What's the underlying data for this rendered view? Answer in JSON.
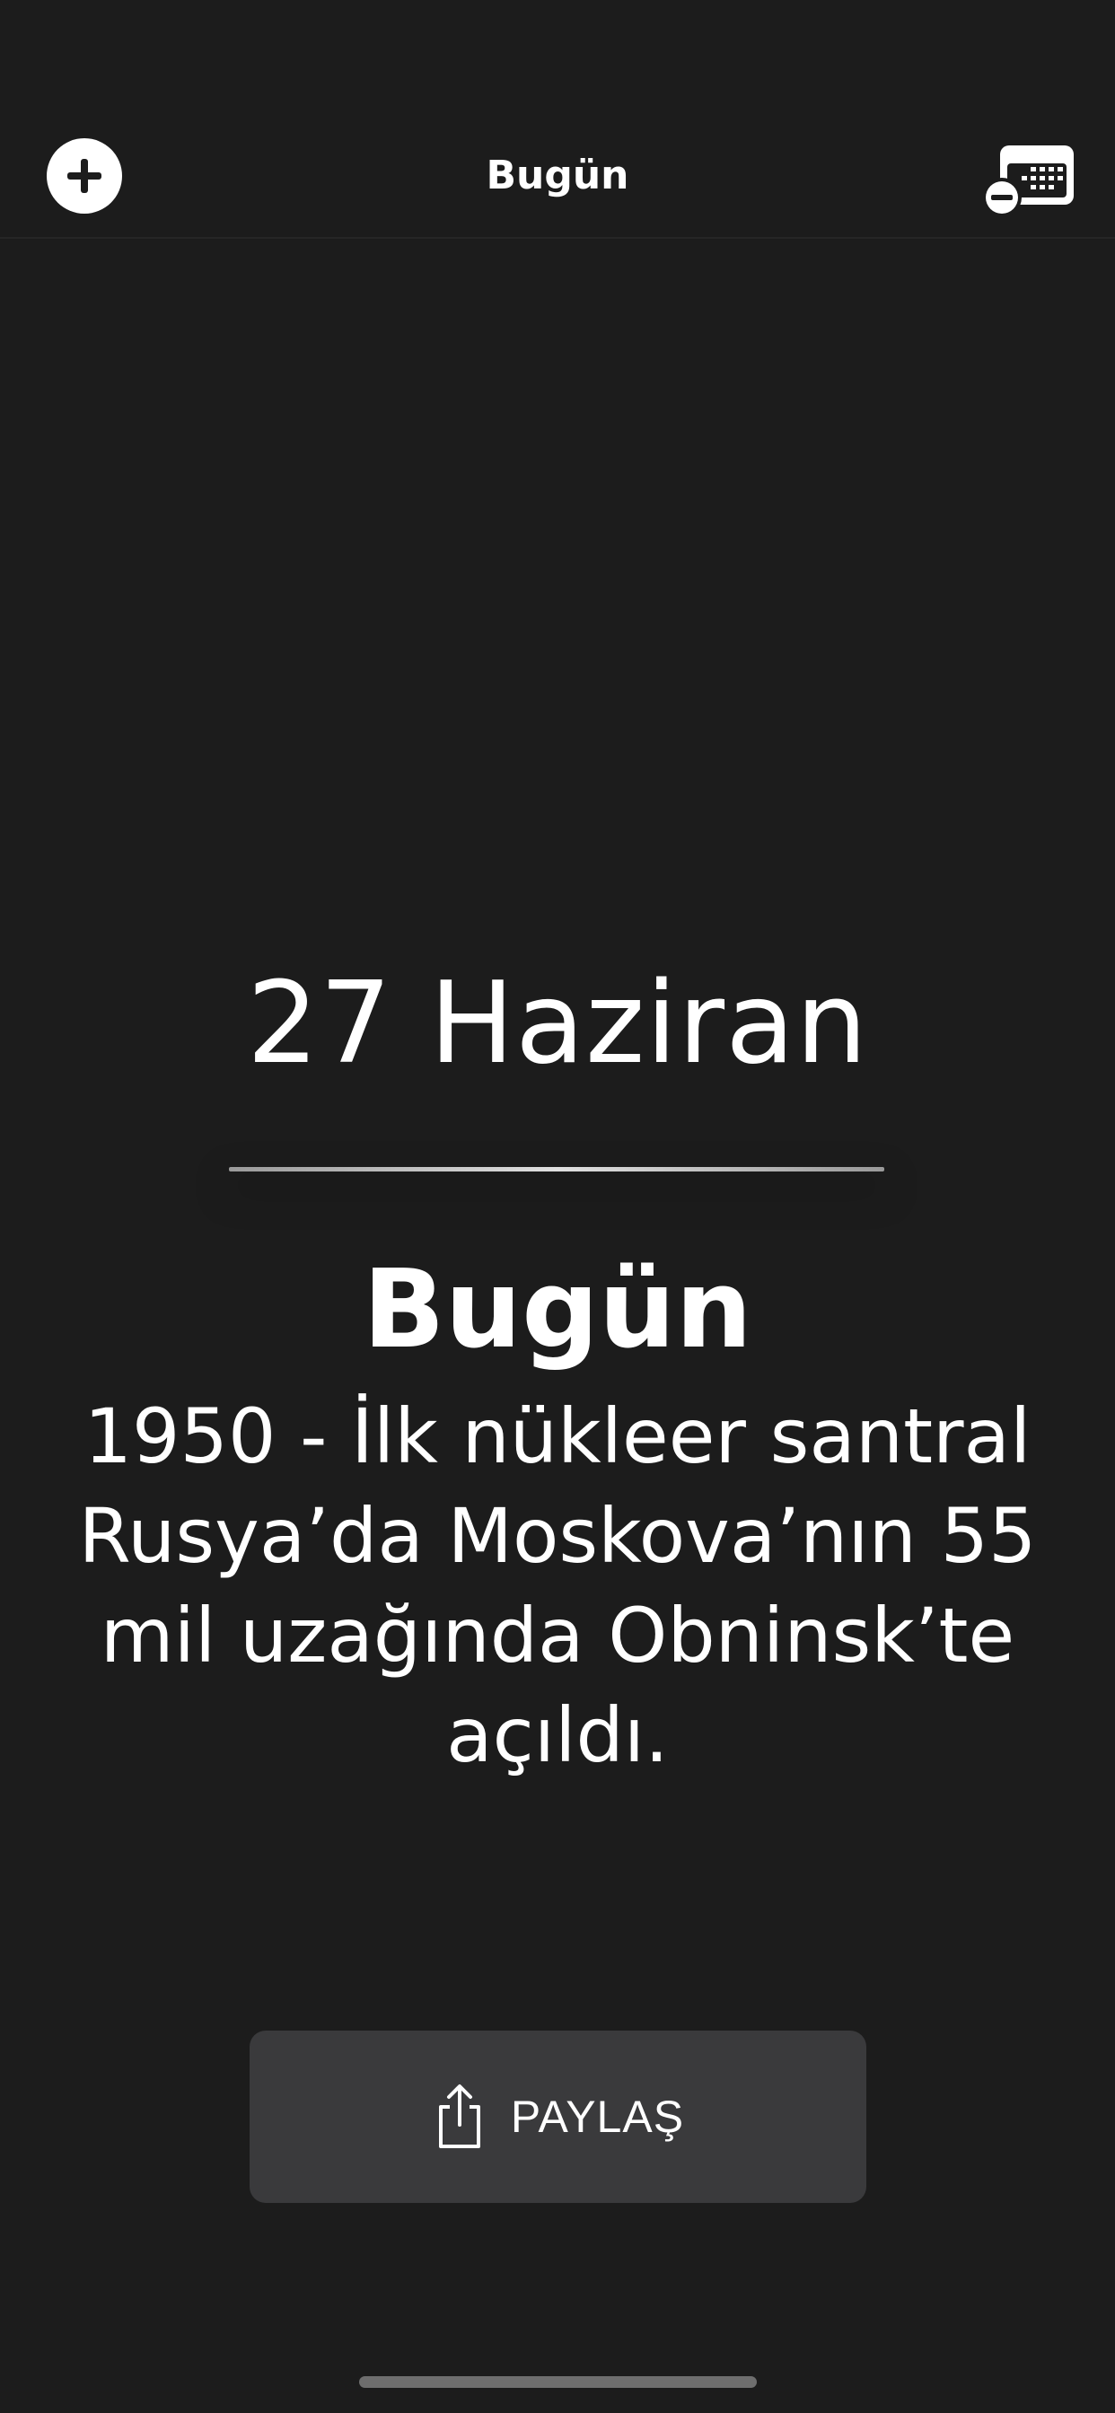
{
  "nav": {
    "title": "Bugün",
    "add_icon": "plus-circle-icon",
    "calendar_icon": "calendar-minus-icon"
  },
  "content": {
    "date": "27 Haziran",
    "heading": "Bugün",
    "event": "1950 - İlk nükleer santral Rusya’da Moskova’nın 55 mil uzağında Obninsk’te açıldı."
  },
  "share": {
    "label": "PAYLAŞ",
    "icon": "share-icon"
  },
  "colors": {
    "background": "#1c1c1c",
    "button": "#3a3a3c",
    "text": "#ffffff"
  }
}
